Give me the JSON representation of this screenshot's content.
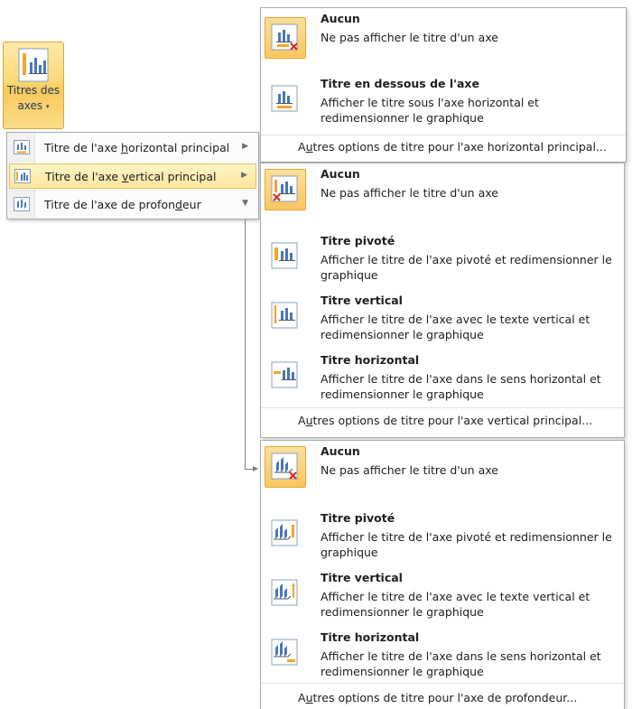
{
  "ribbon_button": {
    "label_line1": "Titres des",
    "label_line2": "axes",
    "dropdown_arrow": "▾"
  },
  "submenu": {
    "items": [
      {
        "prefix": "Titre de l'axe ",
        "hotkey": "h",
        "suffix": "orizontal principal",
        "arrow": "▶"
      },
      {
        "prefix": "Titre de l'axe ",
        "hotkey": "v",
        "suffix": "ertical principal",
        "arrow": "▶"
      },
      {
        "prefix": "Titre de l'axe de profon",
        "hotkey": "d",
        "suffix": "eur",
        "arrow": "▼"
      }
    ]
  },
  "horizontal_panel": {
    "options": [
      {
        "title": "Aucun",
        "desc": "Ne pas afficher le titre d'un axe"
      },
      {
        "title": "Titre en dessous de l'axe",
        "desc": "Afficher le titre sous l'axe horizontal et redimensionner le graphique"
      }
    ],
    "more_prefix": "A",
    "more_hotkey": "u",
    "more_suffix": "tres options de titre pour l'axe horizontal principal..."
  },
  "vertical_panel": {
    "options": [
      {
        "title": "Aucun",
        "desc": "Ne pas afficher le titre d'un axe"
      },
      {
        "title": "Titre pivoté",
        "desc": "Afficher le titre de l'axe pivoté et redimensionner le graphique"
      },
      {
        "title": "Titre vertical",
        "desc": "Afficher le titre de l'axe avec le texte vertical et redimensionner le graphique"
      },
      {
        "title": "Titre horizontal",
        "desc": "Afficher le titre de l'axe dans le sens horizontal et redimensionner le graphique"
      }
    ],
    "more_prefix": "A",
    "more_hotkey": "u",
    "more_suffix": "tres options de titre pour l'axe vertical principal..."
  },
  "depth_panel": {
    "options": [
      {
        "title": "Aucun",
        "desc": "Ne pas afficher le titre d'un axe"
      },
      {
        "title": "Titre pivoté",
        "desc": "Afficher le titre de l'axe pivoté et redimensionner le graphique"
      },
      {
        "title": "Titre vertical",
        "desc": "Afficher le titre de l'axe avec le texte vertical et redimensionner le graphique"
      },
      {
        "title": "Titre horizontal",
        "desc": "Afficher le titre de l'axe dans le sens horizontal et redimensionner le graphique"
      }
    ],
    "more_prefix": "A",
    "more_hotkey": "u",
    "more_suffix": "tres options de titre pour l'axe de profondeur..."
  },
  "colors": {
    "selection_border": "#e0a833",
    "selection_fill": "#f9c660",
    "accent_orange": "#f3a531",
    "icon_blue": "#4a78b8"
  }
}
